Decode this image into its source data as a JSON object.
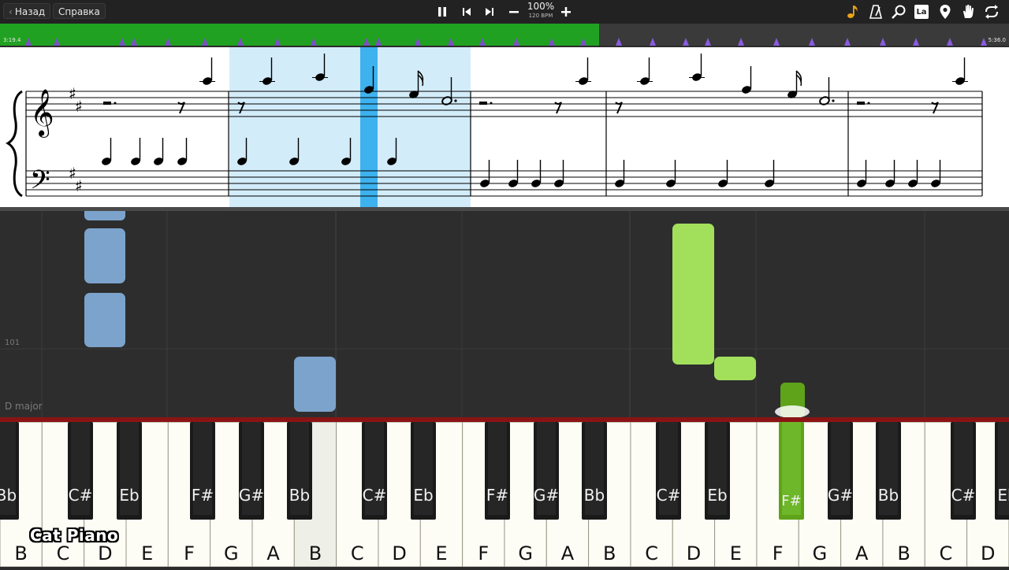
{
  "topbar": {
    "back_label": "Назад",
    "help_label": "Справка",
    "zoom_percent": "100%",
    "tempo": "120 BPM",
    "icons": [
      "pause-icon",
      "skip-back-icon",
      "skip-forward-icon",
      "minus-icon",
      "plus-icon",
      "note-icon",
      "metronome-icon",
      "magnifier-icon",
      "solfege-icon",
      "location-pin-icon",
      "hand-icon",
      "loop-icon"
    ],
    "solfege_label": "La"
  },
  "timeline": {
    "time_start": "3:19.4",
    "time_end": "5:36.0",
    "progress": 0.594,
    "played_color": "#21a121"
  },
  "score": {
    "highlight_color": "#d3ecfa",
    "cursor_color": "#3db2ee"
  },
  "roll": {
    "row_label": "101",
    "key_label": "D major",
    "left_hand_color": "#7ca3cc",
    "right_hand_color": "#a2e05c",
    "active_note_color": "#5fa31a"
  },
  "keyboard": {
    "white_labels": [
      "B",
      "C",
      "D",
      "E",
      "F",
      "G",
      "A",
      "B",
      "C",
      "D",
      "E",
      "F",
      "G",
      "A",
      "B",
      "C",
      "D",
      "E",
      "F",
      "G",
      "A",
      "B",
      "C",
      "D"
    ],
    "black_labels": [
      "Bb",
      "C#",
      "Eb",
      "F#",
      "G#",
      "Bb",
      "C#",
      "Eb",
      "F#",
      "G#",
      "Bb",
      "C#",
      "Eb",
      "F#",
      "G#",
      "Bb",
      "C#",
      "Eb"
    ],
    "active_key": "F#"
  },
  "watermark": "Cat Piano"
}
